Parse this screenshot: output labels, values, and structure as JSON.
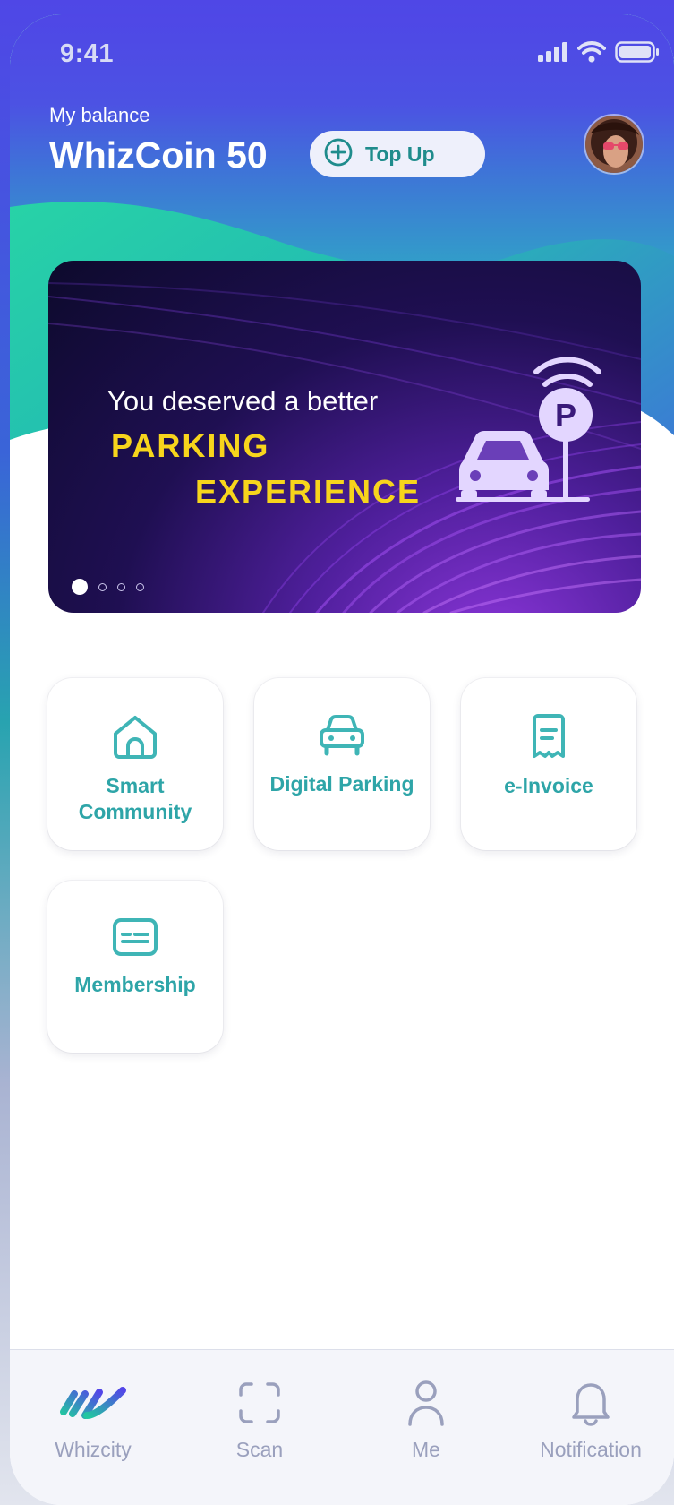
{
  "status_bar": {
    "time": "9:41",
    "signal_icon": "signal-bars-icon",
    "wifi_icon": "wifi-icon",
    "battery_icon": "battery-icon"
  },
  "balance": {
    "label": "My balance",
    "value": "WhizCoin 50"
  },
  "topup": {
    "icon": "plus-circle-icon",
    "label": "Top Up"
  },
  "profile": {
    "avatar_icon": "user-avatar"
  },
  "banner": {
    "line1": "You deserved a better",
    "line2": "PARKING",
    "line3": "EXPERIENCE",
    "art_icon": "car-parking-icon",
    "slides_total": 4,
    "active_slide": 1
  },
  "services": [
    {
      "label": "Smart Community",
      "icon": "home-icon"
    },
    {
      "label": "Digital Parking",
      "icon": "car-icon"
    },
    {
      "label": "e-Invoice",
      "icon": "receipt-icon"
    },
    {
      "label": "Membership",
      "icon": "membership-card-icon"
    }
  ],
  "tabs": [
    {
      "label": "Whizcity",
      "icon": "whizcity-logo-icon",
      "active": true
    },
    {
      "label": "Scan",
      "icon": "scan-frame-icon",
      "active": false
    },
    {
      "label": "Me",
      "icon": "person-icon",
      "active": false
    },
    {
      "label": "Notification",
      "icon": "bell-icon",
      "active": false
    }
  ],
  "colors": {
    "header_purple": "#4f47e6",
    "header_teal": "#22c2a6",
    "accent_teal": "#2ea5a8",
    "banner_yellow": "#f7d51c",
    "tab_inactive": "#9aa0bd"
  }
}
